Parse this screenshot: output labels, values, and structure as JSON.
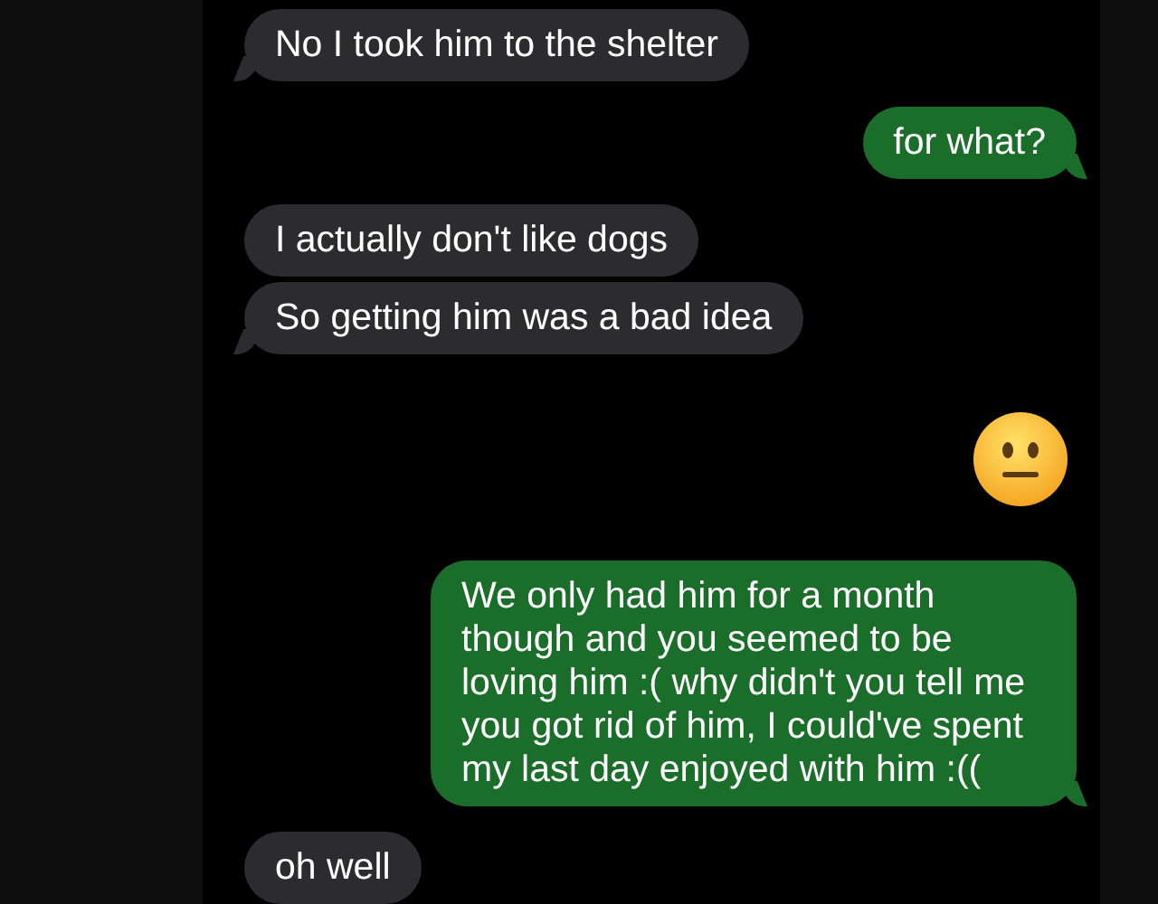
{
  "messages": [
    {
      "kind": "received",
      "text": "No I took him to the shelter"
    },
    {
      "kind": "sent",
      "text": "for what?"
    },
    {
      "kind": "received",
      "text": "I actually don't like dogs"
    },
    {
      "kind": "received",
      "text": "So getting him was a bad idea"
    },
    {
      "kind": "emoji"
    },
    {
      "kind": "sent",
      "text": "We only had him for a month though and you seemed to be loving him :( why didn't you tell me you got rid of him, I could've spent my last day enjoyed with him :(("
    },
    {
      "kind": "received",
      "text": "oh well"
    }
  ]
}
